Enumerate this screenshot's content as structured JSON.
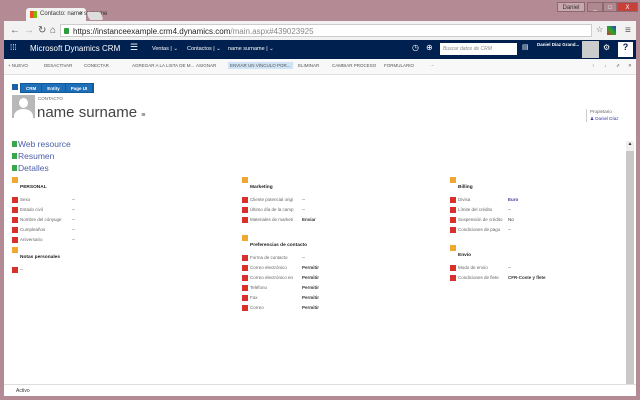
{
  "browser": {
    "tab_title": "Contacto: name surname",
    "url_host": "https://instanceexample.crm4.dynamics.com",
    "url_path": "/main.aspx#439023925",
    "user_badge": "Daniel",
    "window_min": "_",
    "window_max": "□",
    "window_close": "X"
  },
  "nav": {
    "app": "Microsoft Dynamics CRM",
    "breadcrumbs": [
      "Ventas",
      "Contactos",
      "name surname"
    ],
    "search_placeholder": "Buscar datos de CRM",
    "user": "Daniel Díaz Grand..."
  },
  "commands": [
    "+ NUEVO",
    "DESACTIVAR",
    "CONECTAR",
    "AGREGAR A LA LISTA DE M...",
    "ASIGNAR",
    "ENVIAR UN VÍNCULO POR...",
    "ELIMINAR",
    "CAMBIAR PROCESO",
    "FORMULARIO",
    "···"
  ],
  "ribbon": [
    "CRM",
    "Entity",
    "Page UI"
  ],
  "header": {
    "entity": "CONTACTO",
    "name": "name surname",
    "owner_label": "Propietario",
    "owner": "Daniel Díaz"
  },
  "sections": [
    "Web resource",
    "Resumen",
    "Detalles"
  ],
  "personal": {
    "title": "PERSONAL",
    "rows": [
      [
        "Sexo",
        "--"
      ],
      [
        "Estado civil",
        "--"
      ],
      [
        "Nombre del cónyuge",
        "--"
      ],
      [
        "Cumpleaños",
        "--"
      ],
      [
        "Aniversario",
        "--"
      ]
    ]
  },
  "notas": {
    "title": "Notas personales",
    "value": "--"
  },
  "marketing": {
    "title": "Marketing",
    "rows": [
      [
        "Cliente potencial origi",
        "--"
      ],
      [
        "Último día de la camp",
        "--"
      ],
      [
        "Materiales de marketi",
        "Enviar"
      ]
    ]
  },
  "preferencias": {
    "title": "Preferencias de contacto",
    "rows": [
      [
        "Forma de contacto",
        "--"
      ],
      [
        "Correo electrónico",
        "Permitir"
      ],
      [
        "Correo electrónico en",
        "Permitir"
      ],
      [
        "Teléfono",
        "Permitir"
      ],
      [
        "Fax",
        "Permitir"
      ],
      [
        "Correo",
        "Permitir"
      ]
    ]
  },
  "billing": {
    "title": "Billing",
    "rows": [
      [
        "Divisa",
        "Euro"
      ],
      [
        "Límite del crédito",
        "--"
      ],
      [
        "Suspensión de crédito",
        "No"
      ],
      [
        "Condiciones de pago",
        "--"
      ]
    ]
  },
  "envio": {
    "title": "Envío",
    "rows": [
      [
        "Modo de envío",
        "--"
      ],
      [
        "Condiciones de flete",
        "CFR-Coste y flete"
      ]
    ]
  },
  "status": "Activo"
}
